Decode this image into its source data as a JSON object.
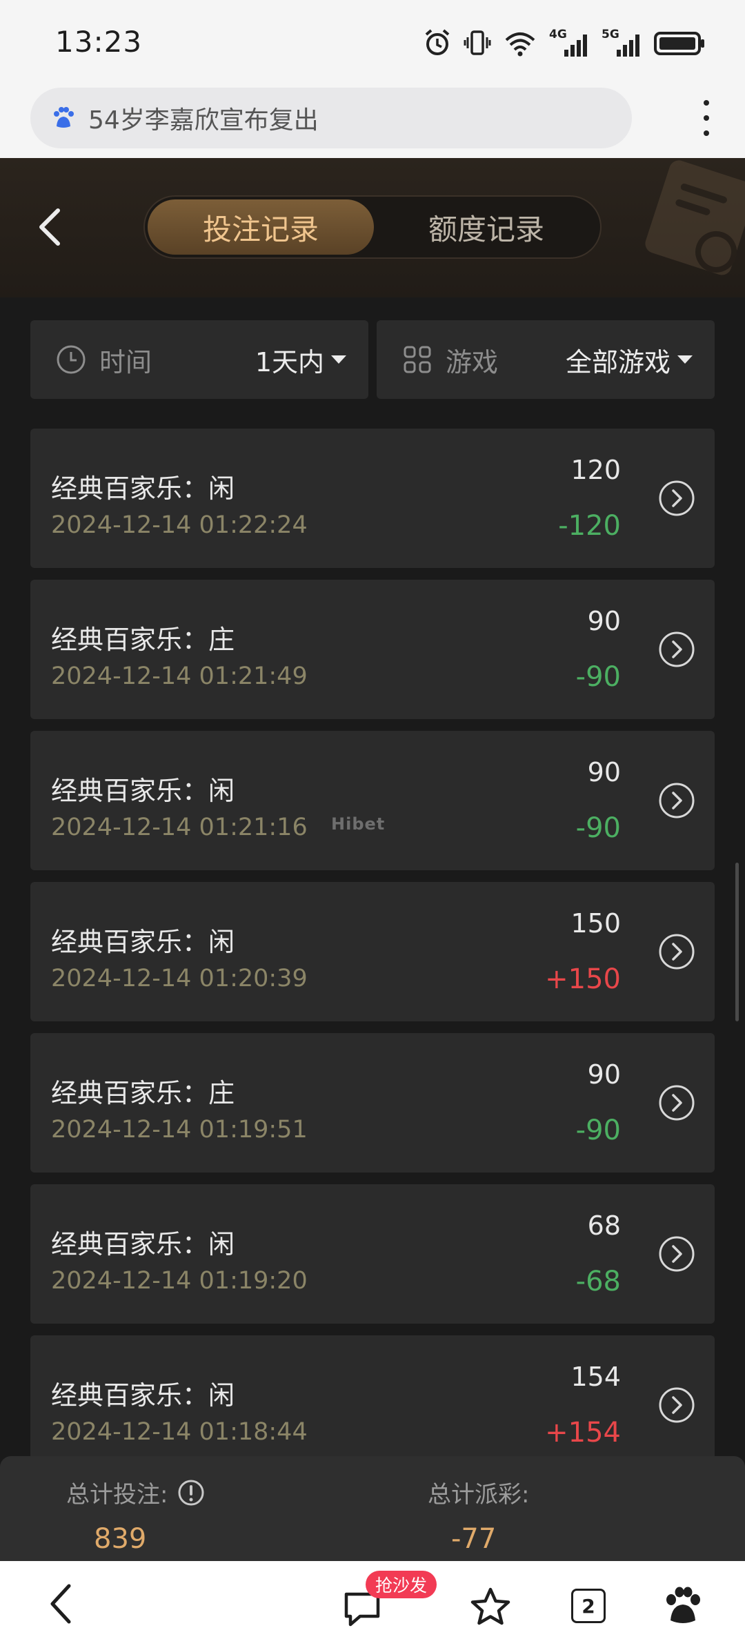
{
  "status_bar": {
    "time": "13:23",
    "icons": [
      "alarm-icon",
      "vibrate-icon",
      "wifi-icon",
      "signal-4g-icon",
      "signal-5g-icon",
      "battery-icon"
    ],
    "net1": "4G",
    "net2": "5G"
  },
  "browser": {
    "search_text": "54岁李嘉欣宣布复出",
    "search_icon": "baidu-paw-icon",
    "menu_icon": "more-vertical-icon"
  },
  "header": {
    "tabs": [
      {
        "label": "投注记录",
        "active": true
      },
      {
        "label": "额度记录",
        "active": false
      }
    ]
  },
  "filters": {
    "time_label": "时间",
    "time_value": "1天内",
    "game_label": "游戏",
    "game_value": "全部游戏"
  },
  "records": [
    {
      "game": "经典百家乐：闲",
      "time": "2024-12-14 01:22:24",
      "bet": "120",
      "payout": "-120"
    },
    {
      "game": "经典百家乐：庄",
      "time": "2024-12-14 01:21:49",
      "bet": "90",
      "payout": "-90"
    },
    {
      "game": "经典百家乐：闲",
      "time": "2024-12-14 01:21:16",
      "bet": "90",
      "payout": "-90"
    },
    {
      "game": "经典百家乐：闲",
      "time": "2024-12-14 01:20:39",
      "bet": "150",
      "payout": "+150"
    },
    {
      "game": "经典百家乐：庄",
      "time": "2024-12-14 01:19:51",
      "bet": "90",
      "payout": "-90"
    },
    {
      "game": "经典百家乐：闲",
      "time": "2024-12-14 01:19:20",
      "bet": "68",
      "payout": "-68"
    },
    {
      "game": "经典百家乐：闲",
      "time": "2024-12-14 01:18:44",
      "bet": "154",
      "payout": "+154"
    }
  ],
  "watermark": "Hibet",
  "summary": {
    "total_bet_label": "总计投注:",
    "total_bet_value": "839",
    "total_payout_label": "总计派彩:",
    "total_payout_value": "-77"
  },
  "bottom_nav": {
    "badge": "抢沙发",
    "tab_count": "2"
  },
  "colors": {
    "accent_gold": "#e0aa6a",
    "active_tab_text": "#f0c58e",
    "loss_green": "#4caf62",
    "win_red": "#e8474a",
    "card_bg": "#2b2b2b"
  }
}
